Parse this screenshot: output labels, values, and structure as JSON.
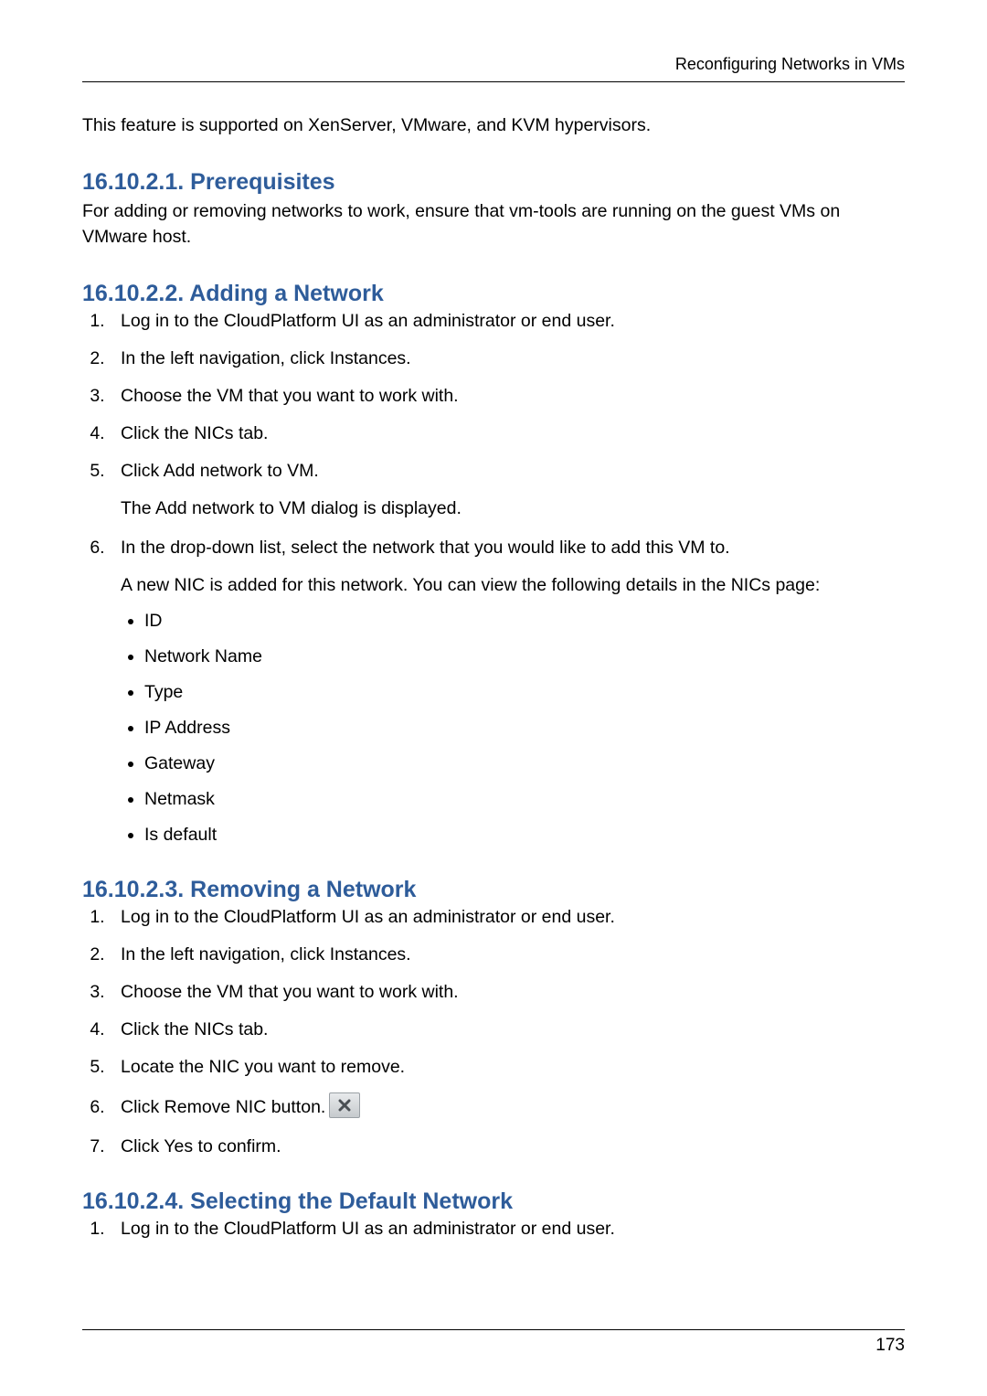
{
  "header": {
    "running_title": "Reconfiguring Networks in VMs"
  },
  "intro": {
    "text": "This feature is supported on XenServer, VMware, and KVM hypervisors."
  },
  "sections": {
    "prereq": {
      "title": "16.10.2.1. Prerequisites",
      "body": "For adding or removing networks to work, ensure that vm-tools are running on the guest VMs on VMware host."
    },
    "adding": {
      "title": "16.10.2.2. Adding a Network",
      "steps": {
        "s1": "Log in to the CloudPlatform UI as an administrator or end user.",
        "s2": "In the left navigation, click Instances.",
        "s3": "Choose the VM that you want to work with.",
        "s4": "Click the NICs tab.",
        "s5": "Click Add network to VM.",
        "s5b": "The Add network to VM dialog is displayed.",
        "s6": "In the drop-down list, select the network that you would like to add this VM to.",
        "s6b": "A new NIC is added for this network. You can view the following details in the NICs page:",
        "bullets": {
          "b1": "ID",
          "b2": "Network Name",
          "b3": "Type",
          "b4": "IP Address",
          "b5": "Gateway",
          "b6": "Netmask",
          "b7": "Is default"
        }
      }
    },
    "removing": {
      "title": "16.10.2.3. Removing a Network",
      "steps": {
        "s1": "Log in to the CloudPlatform UI as an administrator or end user.",
        "s2": "In the left navigation, click Instances.",
        "s3": "Choose the VM that you want to work with.",
        "s4": "Click the NICs tab.",
        "s5": "Locate the NIC you want to remove.",
        "s6": "Click Remove NIC button.",
        "s7": "Click Yes to confirm."
      }
    },
    "selecting": {
      "title": "16.10.2.4. Selecting the Default Network",
      "steps": {
        "s1": "Log in to the CloudPlatform UI as an administrator or end user."
      }
    }
  },
  "footer": {
    "page_number": "173"
  }
}
